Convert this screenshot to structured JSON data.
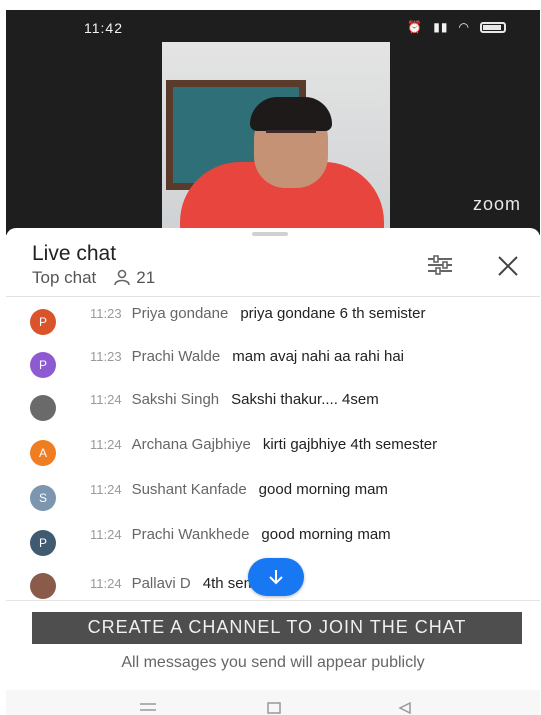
{
  "status_bar": {
    "time": "11:42",
    "icons": [
      "alarm-icon",
      "signal-icon",
      "wifi-icon",
      "battery-icon"
    ]
  },
  "video": {
    "watermark": "zoom"
  },
  "chat": {
    "title": "Live chat",
    "mode_label": "Top chat",
    "viewer_count": "21",
    "messages": [
      {
        "avatar_letter": "P",
        "avatar_color": "#d9542b",
        "time": "11:23",
        "author": "Priya gondane",
        "text": "priya gondane 6 th semister"
      },
      {
        "avatar_letter": "P",
        "avatar_color": "#8e5ad2",
        "time": "11:23",
        "author": "Prachi Walde",
        "text": "mam avaj nahi aa rahi hai"
      },
      {
        "avatar_letter": "",
        "avatar_color": "#6a6a6a",
        "time": "11:24",
        "author": "Sakshi Singh",
        "text": "Sakshi thakur.... 4sem"
      },
      {
        "avatar_letter": "A",
        "avatar_color": "#ef7d22",
        "time": "11:24",
        "author": "Archana Gajbhiye",
        "text": "kirti gajbhiye 4th semester"
      },
      {
        "avatar_letter": "S",
        "avatar_color": "#7c96b0",
        "time": "11:24",
        "author": "Sushant Kanfade",
        "text": "good morning mam"
      },
      {
        "avatar_letter": "P",
        "avatar_color": "#405a72",
        "time": "11:24",
        "author": "Prachi Wankhede",
        "text": "good morning mam"
      },
      {
        "avatar_letter": "",
        "avatar_color": "#8a5a4a",
        "time": "11:24",
        "author": "Pallavi D",
        "text": "4th sem"
      }
    ]
  },
  "footer": {
    "create_channel_label": "CREATE A CHANNEL TO JOIN THE CHAT",
    "public_note": "All messages you send will appear publicly"
  },
  "colors": {
    "accent": "#1877f2",
    "button_bg": "#4e4e4e"
  }
}
